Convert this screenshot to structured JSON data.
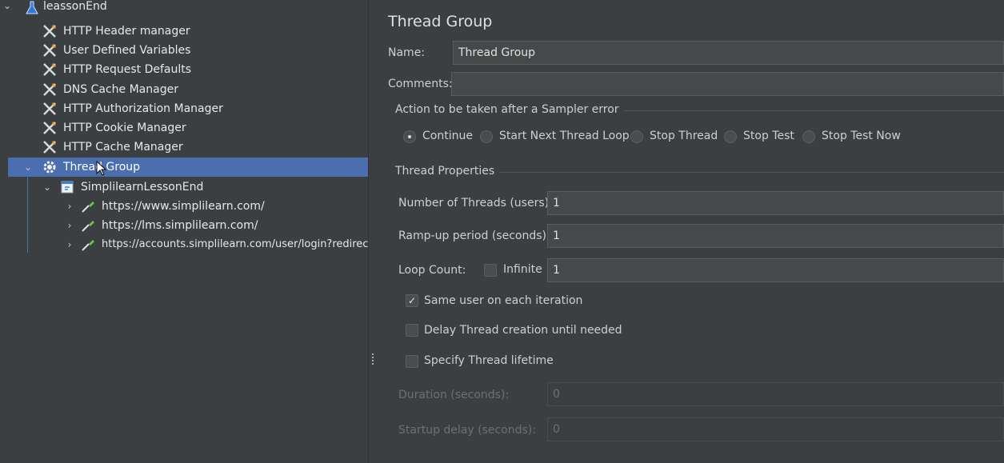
{
  "tree": {
    "root": {
      "label": "leassonEnd",
      "icon": "flask-icon"
    },
    "config_items": [
      {
        "label": "HTTP Header manager",
        "icon": "wrench-tools-icon"
      },
      {
        "label": "User Defined Variables",
        "icon": "wrench-tools-icon"
      },
      {
        "label": "HTTP Request Defaults",
        "icon": "wrench-tools-icon"
      },
      {
        "label": "DNS Cache Manager",
        "icon": "wrench-tools-icon"
      },
      {
        "label": "HTTP Authorization Manager",
        "icon": "wrench-tools-icon"
      },
      {
        "label": "HTTP Cookie Manager",
        "icon": "wrench-tools-icon"
      },
      {
        "label": "HTTP Cache Manager",
        "icon": "wrench-tools-icon"
      }
    ],
    "thread_group": {
      "label": "Thread Group",
      "icon": "gear-icon"
    },
    "controller": {
      "label": "SimplilearnLessonEnd",
      "icon": "script-controller-icon"
    },
    "samplers": [
      {
        "label": "https://www.simplilearn.com/",
        "icon": "pipette-sampler-icon"
      },
      {
        "label": "https://lms.simplilearn.com/",
        "icon": "pipette-sampler-icon"
      },
      {
        "label": "https://accounts.simplilearn.com/user/login?redirect",
        "icon": "pipette-sampler-icon"
      }
    ]
  },
  "panel": {
    "title": "Thread Group",
    "name_label": "Name:",
    "name_value": "Thread Group",
    "comments_label": "Comments:",
    "comments_value": "",
    "error_section_title": "Action to be taken after a Sampler error",
    "error_options": [
      {
        "label": "Continue",
        "selected": true
      },
      {
        "label": "Start Next Thread Loop",
        "selected": false
      },
      {
        "label": "Stop Thread",
        "selected": false
      },
      {
        "label": "Stop Test",
        "selected": false
      },
      {
        "label": "Stop Test Now",
        "selected": false
      }
    ],
    "props_section_title": "Thread Properties",
    "threads_label": "Number of Threads (users):",
    "threads_value": "1",
    "rampup_label": "Ramp-up period (seconds):",
    "rampup_value": "1",
    "loop_label": "Loop Count:",
    "infinite_label": "Infinite",
    "infinite_checked": false,
    "loop_value": "1",
    "same_user_label": "Same user on each iteration",
    "same_user_checked": true,
    "delay_label": "Delay Thread creation until needed",
    "delay_checked": false,
    "lifetime_label": "Specify Thread lifetime",
    "lifetime_checked": false,
    "duration_label": "Duration (seconds):",
    "duration_value": "0",
    "startup_label": "Startup delay (seconds):",
    "startup_value": "0"
  },
  "colors": {
    "selection": "#4b6eaf",
    "background": "#3c3f41",
    "field": "#45494a"
  }
}
